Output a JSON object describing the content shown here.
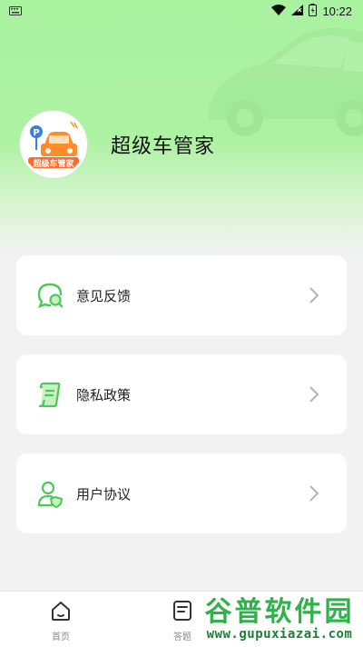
{
  "status_bar": {
    "time": "10:22",
    "icons": [
      "keyboard-icon",
      "wifi-icon",
      "signal-icon",
      "battery-icon"
    ]
  },
  "profile": {
    "app_title": "超级车管家",
    "avatar_text": "超级车管家"
  },
  "menu": {
    "items": [
      {
        "label": "意见反馈",
        "icon": "feedback-icon"
      },
      {
        "label": "隐私政策",
        "icon": "privacy-icon"
      },
      {
        "label": "用户协议",
        "icon": "user-agreement-icon"
      }
    ]
  },
  "tabbar": {
    "tabs": [
      {
        "label": "首页",
        "icon": "home-icon"
      },
      {
        "label": "答题",
        "icon": "quiz-icon"
      }
    ]
  },
  "watermark": {
    "title": "谷普软件园",
    "url": "www.gupuxiazai.com"
  },
  "colors": {
    "accent": "#4cc85a",
    "hero_green": "#aaf2a0",
    "watermark_green": "#2db34a"
  }
}
